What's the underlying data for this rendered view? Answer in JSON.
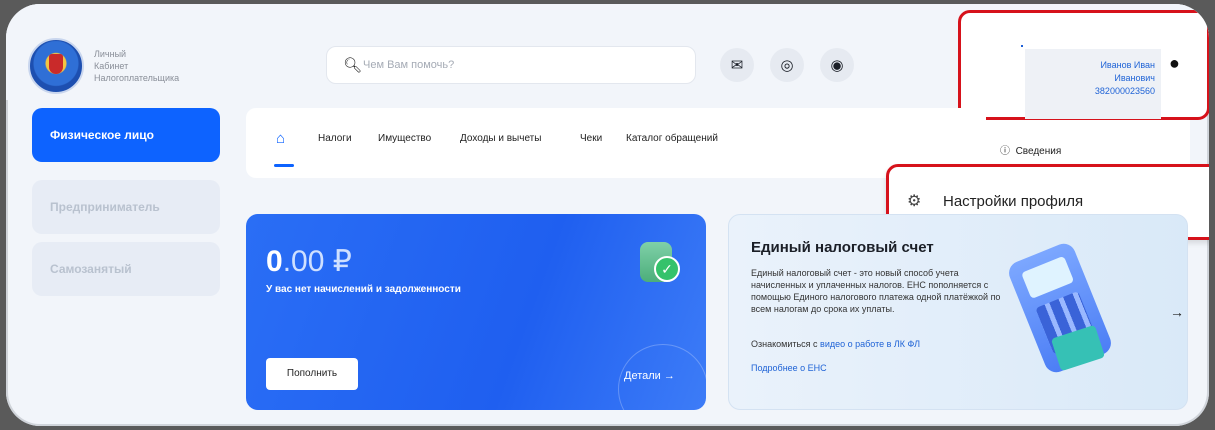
{
  "brand": {
    "line1": "Личный",
    "line2": "Кабинет",
    "line3": "Налогоплательщика"
  },
  "search": {
    "placeholder": "Чем Вам помочь?"
  },
  "header_icons": [
    "mail-icon",
    "eye-off-icon",
    "lightbulb-icon"
  ],
  "profile": {
    "name_line1": "Иванов Иван",
    "name_line2": "Иванович",
    "inn": "382000023560",
    "icon": "user-icon"
  },
  "sidebar": {
    "items": [
      {
        "label": "Физическое лицо",
        "active": true
      },
      {
        "label": "Предприниматель",
        "active": false
      },
      {
        "label": "Самозанятый",
        "active": false
      }
    ]
  },
  "nav": {
    "home_icon": "home-icon",
    "items": [
      "Налоги",
      "Имущество",
      "Доходы и вычеты",
      "Чеки",
      "Каталог обращений"
    ]
  },
  "profile_menu": {
    "info_label": "Сведения",
    "settings_label": "Настройки профиля"
  },
  "balance": {
    "amount_int": "0",
    "amount_rest": ".00 ₽",
    "message": "У вас нет начислений и задолженности",
    "topup_label": "Пополнить",
    "details_label": "Детали →"
  },
  "ens": {
    "title": "Единый налоговый счет",
    "body": "Единый налоговый счет - это новый способ учета начисленных и уплаченных налогов. ЕНС пополняется с помощью Единого налогового платежа одной платёжкой по всем налогам до срока их уплаты.",
    "video_prefix": "Ознакомиться с ",
    "video_link": "видео о работе в ЛК ФЛ",
    "more_link": "Подробнее о ЕНС"
  },
  "colors": {
    "accent": "#0d63ff",
    "highlight": "#d6121b",
    "link": "#1f63d6"
  }
}
